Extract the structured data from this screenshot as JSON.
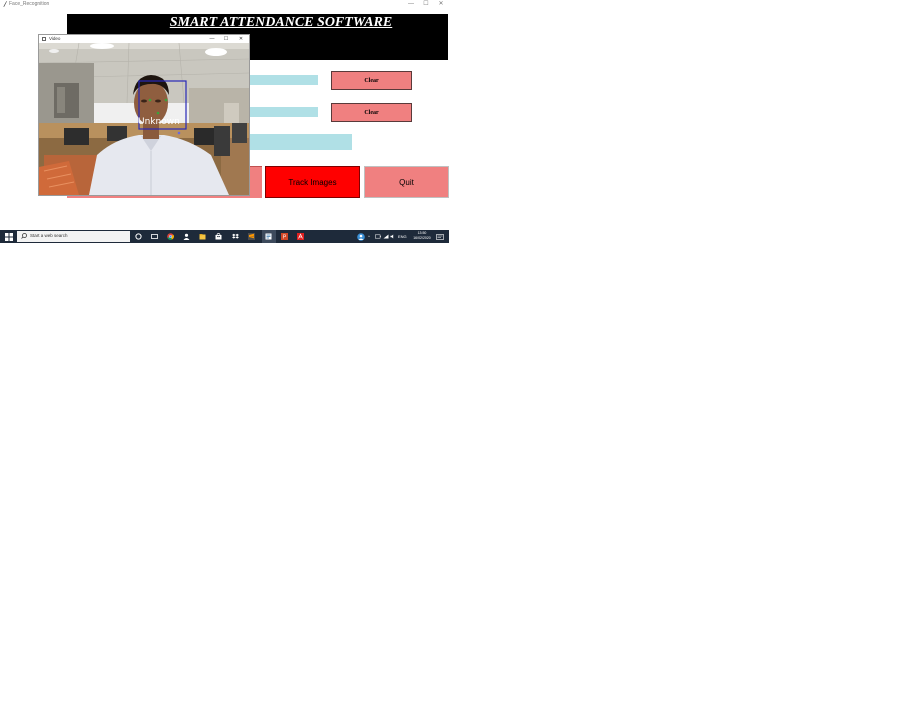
{
  "main_window": {
    "title": "Face_Recognition",
    "controls": {
      "minimize": "—",
      "maximize": "☐",
      "close": "✕"
    }
  },
  "header": {
    "title": "SMART ATTENDANCE SOFTWARE"
  },
  "form": {
    "clear1_label": "Clear",
    "clear2_label": "Clear"
  },
  "buttons": {
    "track_images": "Track Images",
    "quit": "Quit"
  },
  "video_window": {
    "title": "Video",
    "face_label": "Unknown",
    "controls": {
      "minimize": "—",
      "maximize": "☐",
      "close": "✕"
    }
  },
  "taskbar": {
    "search_placeholder": "Start a web search",
    "time": "13:50",
    "date": "16/02/2020",
    "language": "ENG",
    "icons": [
      "windows-start-icon",
      "search-icon",
      "cortana-icon",
      "task-view-icon",
      "chrome-icon",
      "people-icon",
      "file-explorer-icon",
      "store-icon",
      "dropbox-icon",
      "sublime-icon",
      "python-idle-icon",
      "powerpoint-icon",
      "acrobat-icon"
    ]
  },
  "colors": {
    "entry_bg": "#b0e0e6",
    "clear_btn": "#f08080",
    "track_btn": "#ff0000",
    "quit_btn": "#f08080",
    "banner": "#000000",
    "taskbar": "#1e2a3a",
    "face_box": "#3030c0"
  }
}
